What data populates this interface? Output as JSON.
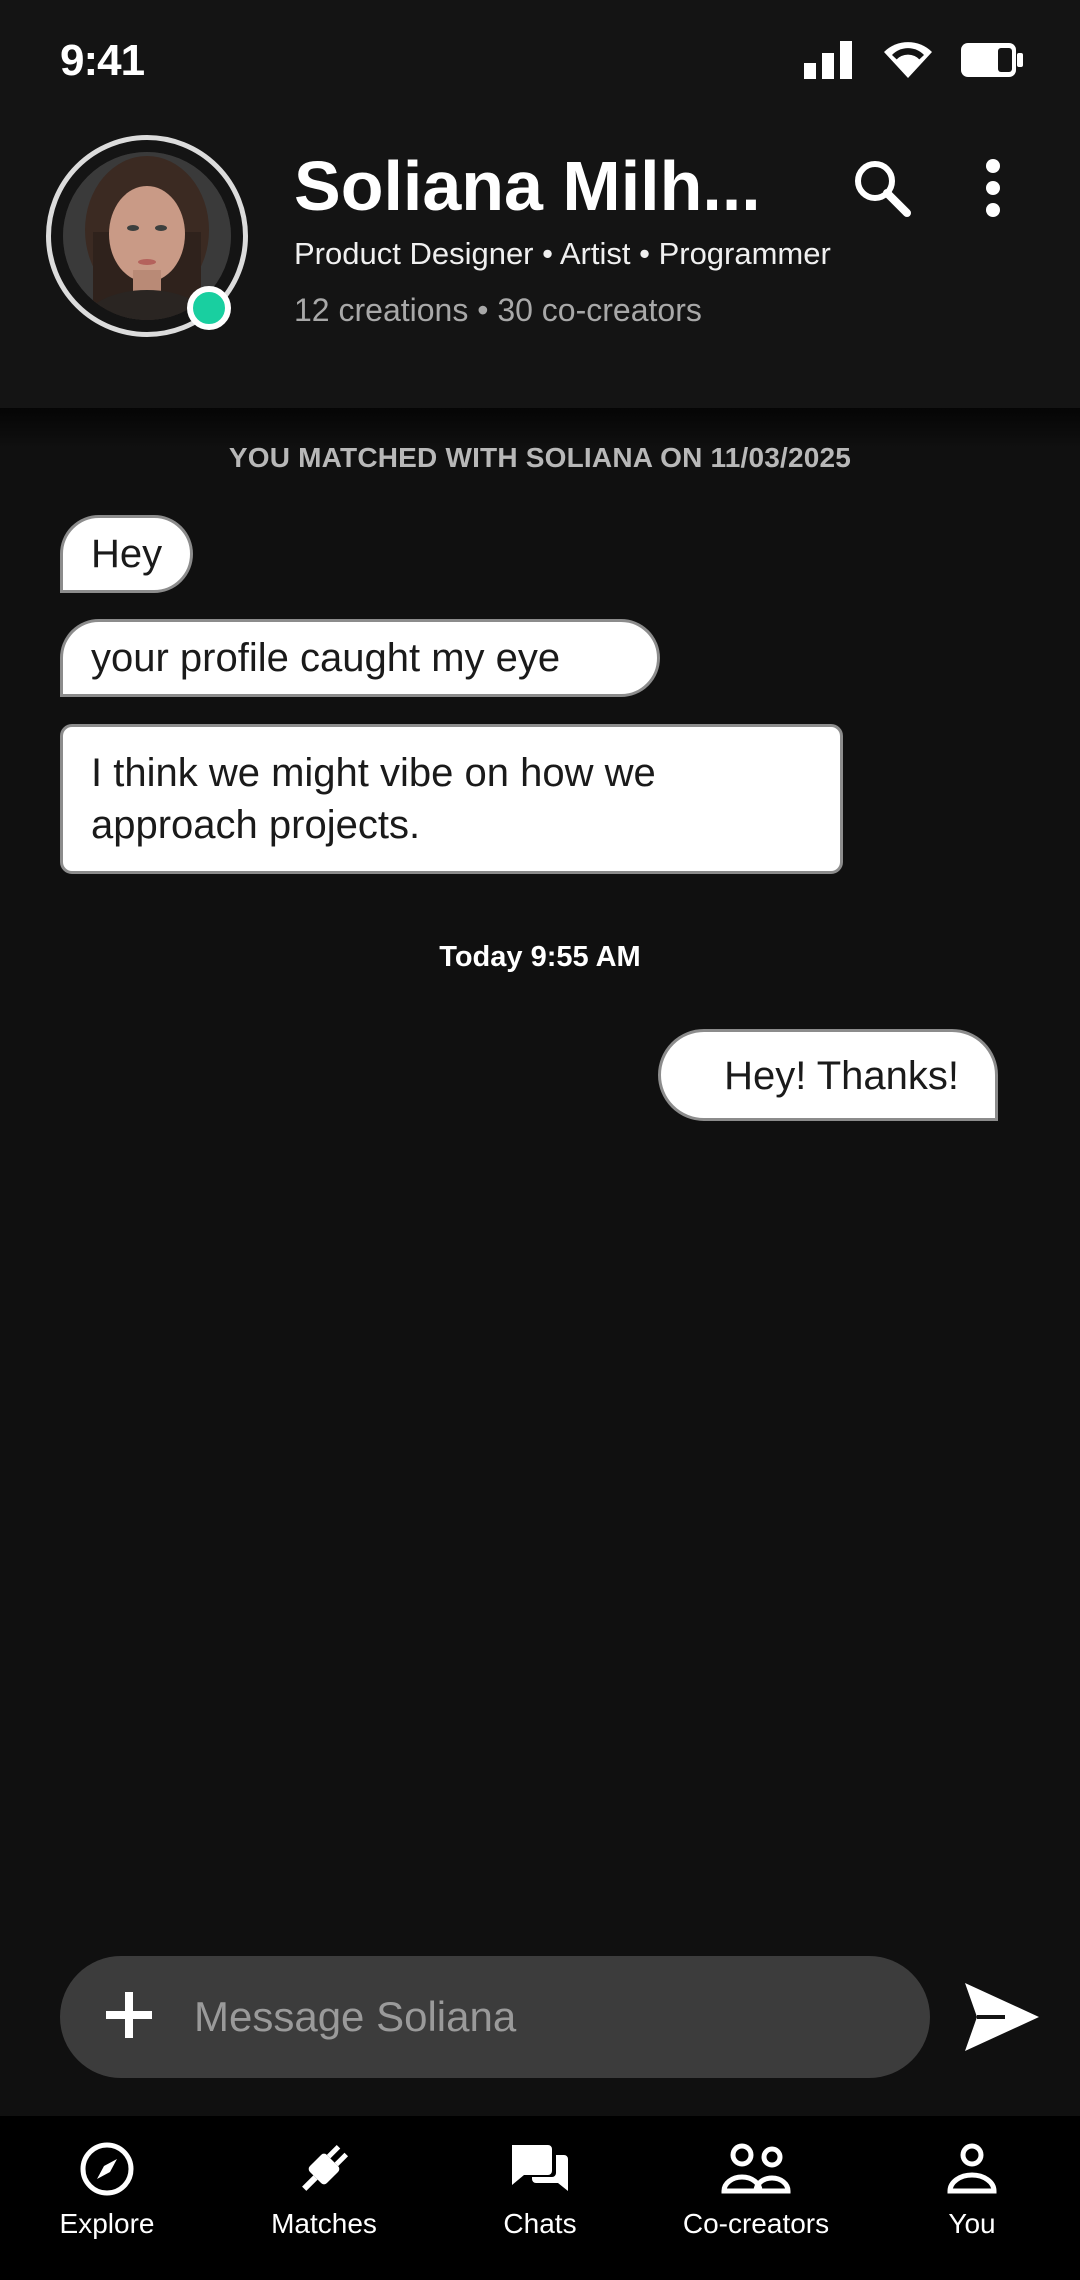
{
  "status_bar": {
    "time": "9:41"
  },
  "header": {
    "name": "Soliana Milh...",
    "roles": "Product Designer • Artist • Programmer",
    "stats": "12 creations • 30 co-creators",
    "online_color": "#19cfa0"
  },
  "chat": {
    "match_banner": "YOU MATCHED WITH SOLIANA ON 11/03/2025",
    "received": [
      "Hey",
      "your profile caught my eye",
      "I think we might vibe on how we approach projects."
    ],
    "timestamp": "Today 9:55 AM",
    "sent": [
      "Hey! Thanks!"
    ]
  },
  "composer": {
    "placeholder": "Message Soliana"
  },
  "nav": {
    "items": [
      {
        "label": "Explore",
        "icon": "compass-icon"
      },
      {
        "label": "Matches",
        "icon": "plug-icon"
      },
      {
        "label": "Chats",
        "icon": "chat-bubbles-icon"
      },
      {
        "label": "Co-creators",
        "icon": "group-icon"
      },
      {
        "label": "You",
        "icon": "person-icon"
      }
    ]
  }
}
